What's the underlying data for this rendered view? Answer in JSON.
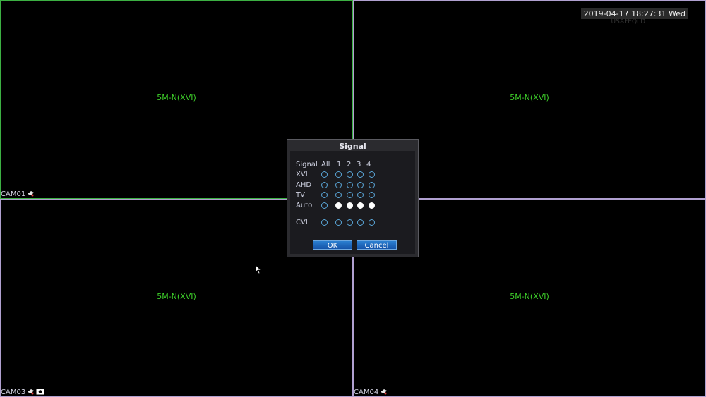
{
  "timestamp": "2019-04-17 18:27:31 Wed",
  "timestamp_sub": "USAFEQLD",
  "panes": [
    {
      "format": "5M-N(XVI)",
      "camera": "CAM01"
    },
    {
      "format": "5M-N(XVI)",
      "camera": ""
    },
    {
      "format": "5M-N(XVI)",
      "camera": "CAM03"
    },
    {
      "format": "5M-N(XVI)",
      "camera": "CAM04"
    }
  ],
  "dialog": {
    "title": "Signal",
    "header": {
      "signal": "Signal",
      "all": "All",
      "channels": [
        "1",
        "2",
        "3",
        "4"
      ]
    },
    "rows": [
      {
        "label": "XVI",
        "all": false,
        "channels": [
          false,
          false,
          false,
          false
        ]
      },
      {
        "label": "AHD",
        "all": false,
        "channels": [
          false,
          false,
          false,
          false
        ]
      },
      {
        "label": "TVI",
        "all": false,
        "channels": [
          false,
          false,
          false,
          false
        ]
      },
      {
        "label": "Auto",
        "all": false,
        "channels": [
          true,
          true,
          true,
          true
        ]
      }
    ],
    "cvi_row": {
      "label": "CVI",
      "all": false,
      "channels": [
        false,
        false,
        false,
        false
      ]
    },
    "ok_label": "OK",
    "cancel_label": "Cancel"
  },
  "colors": {
    "pane_border_active": "#3cb043",
    "pane_border": "#b0a0d0",
    "format_text": "#3ecf2a",
    "accent": "#1f6fc4"
  }
}
